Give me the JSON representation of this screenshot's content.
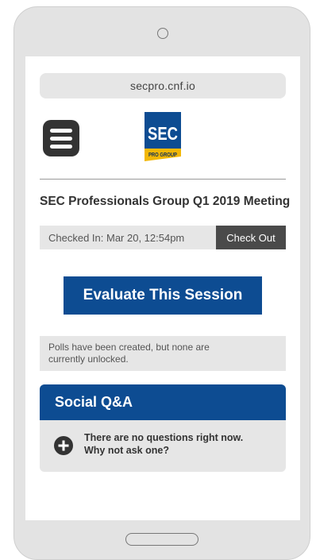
{
  "browser": {
    "url": "secpro.cnf.io"
  },
  "header": {
    "menu_icon": "hamburger-menu-icon",
    "logo": {
      "top_text": "SEC",
      "bottom_text": "PRO GROUP",
      "colors": {
        "blue": "#0d4c92",
        "gold": "#f2b705"
      }
    }
  },
  "session": {
    "title": "SEC Professionals Group Q1 2019 Meeting",
    "checked_in_text": "Checked In: Mar 20, 12:54pm",
    "check_out_label": "Check Out",
    "evaluate_label": "Evaluate This Session"
  },
  "polls": {
    "message_line1": "Polls have been created, but none are",
    "message_line2": "currently unlocked."
  },
  "social_qa": {
    "title": "Social Q&A",
    "empty_line1": "There are no questions right now.",
    "empty_line2": "Why not ask one?",
    "add_icon": "plus-circle-icon"
  },
  "colors": {
    "primary": "#0d4c92",
    "dark": "#333333",
    "panel": "#e6e6e6",
    "checkout": "#4a4a4a"
  }
}
